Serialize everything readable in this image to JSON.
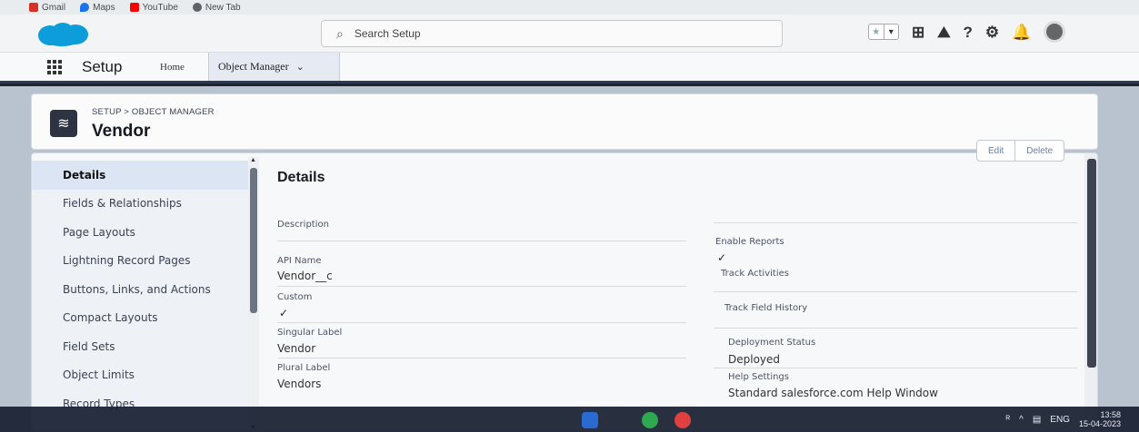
{
  "bookmarks": [
    {
      "label": "Gmail",
      "icon": "gmail-icon",
      "color": "#d93025"
    },
    {
      "label": "Maps",
      "icon": "maps-pin-icon",
      "color": "#1a73e8"
    },
    {
      "label": "YouTube",
      "icon": "youtube-icon",
      "color": "#ff0000"
    },
    {
      "label": "New Tab",
      "icon": "globe-icon",
      "color": "#5f6368"
    }
  ],
  "header": {
    "search_placeholder": "Search Setup",
    "search_icon": "⌕",
    "favorite_star": "★",
    "favorite_dropdown": "▾",
    "icons": {
      "add": "⊞",
      "trailhead": "⛰",
      "help": "?",
      "settings": "⚙",
      "notifications": "🔔"
    },
    "brand_color": "#0d9dda"
  },
  "appnav": {
    "app_name": "Setup",
    "home_label": "Home",
    "active_tab_label": "Object Manager",
    "chevron": "⌄"
  },
  "object": {
    "breadcrumb": "SETUP > OBJECT MANAGER",
    "title": "Vendor",
    "icon": "≋"
  },
  "actions": {
    "edit_label": "Edit",
    "delete_label": "Delete"
  },
  "sidebar": {
    "items": [
      {
        "label": "Details"
      },
      {
        "label": "Fields & Relationships"
      },
      {
        "label": "Page Layouts"
      },
      {
        "label": "Lightning Record Pages"
      },
      {
        "label": "Buttons, Links, and Actions"
      },
      {
        "label": "Compact Layouts"
      },
      {
        "label": "Field Sets"
      },
      {
        "label": "Object Limits"
      },
      {
        "label": "Record Types"
      }
    ]
  },
  "details": {
    "title": "Details",
    "left": {
      "description_label": "Description",
      "api_name_label": "API Name",
      "api_name_value": "Vendor__c",
      "custom_label": "Custom",
      "custom_value": "✓",
      "singular_label_label": "Singular Label",
      "singular_label_value": "Vendor",
      "plural_label_label": "Plural Label",
      "plural_label_value": "Vendors"
    },
    "right": {
      "enable_reports_label": "Enable Reports",
      "enable_reports_value": "✓",
      "track_activities_label": "Track Activities",
      "track_field_history_label": "Track Field History",
      "deployment_status_label": "Deployment Status",
      "deployment_status_value": "Deployed",
      "help_settings_label": "Help Settings",
      "help_settings_value": "Standard salesforce.com Help Window"
    }
  },
  "taskbar": {
    "language": "ENG",
    "time": "13:58",
    "date": "15-04-2023"
  }
}
